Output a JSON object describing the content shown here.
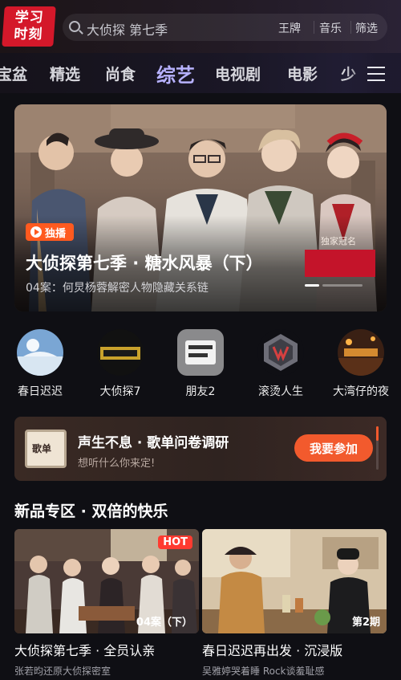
{
  "header": {
    "logo_line1": "学习",
    "logo_line2": "时刻",
    "search_placeholder": "大侦探 第七季",
    "quick_links": [
      "王牌",
      "音乐",
      "筛选"
    ]
  },
  "tabs": [
    "宝盆",
    "精选",
    "尚食",
    "综艺",
    "电视剧",
    "电影",
    "少"
  ],
  "active_tab": "综艺",
  "hero": {
    "badge": "独播",
    "sponsor": "独家冠名",
    "title": "大侦探第七季 · 糖水风暴（下）",
    "subtitle": "04案：何炅杨蓉解密人物隐藏关系链"
  },
  "shortcuts": [
    {
      "label": "春日迟迟",
      "icon": "spring-show-icon"
    },
    {
      "label": "大侦探7",
      "icon": "detective-show-icon"
    },
    {
      "label": "朋友2",
      "icon": "friends-show-icon"
    },
    {
      "label": "滚烫人生",
      "icon": "hot-life-show-icon"
    },
    {
      "label": "大湾仔的夜",
      "icon": "bay-night-show-icon"
    }
  ],
  "survey": {
    "icon_text": "歌单",
    "title": "声生不息 · 歌单问卷调研",
    "subtitle": "想听什么你来定!",
    "button": "我要参加"
  },
  "section": {
    "title": "新品专区 · 双倍的快乐",
    "cards": [
      {
        "title": "大侦探第七季 · 全员认亲",
        "subtitle": "张若昀还原大侦探密室",
        "badge": "HOT",
        "episode": "04案（下）"
      },
      {
        "title": "春日迟迟再出发 · 沉浸版",
        "subtitle": "吴雅婷哭着睡 Rock谈羞耻感",
        "badge": "",
        "episode": "第2期"
      }
    ]
  },
  "colors": {
    "accent": "#f25a2d",
    "active_tab": "#b7b2ff",
    "logo": "#d4182a"
  }
}
